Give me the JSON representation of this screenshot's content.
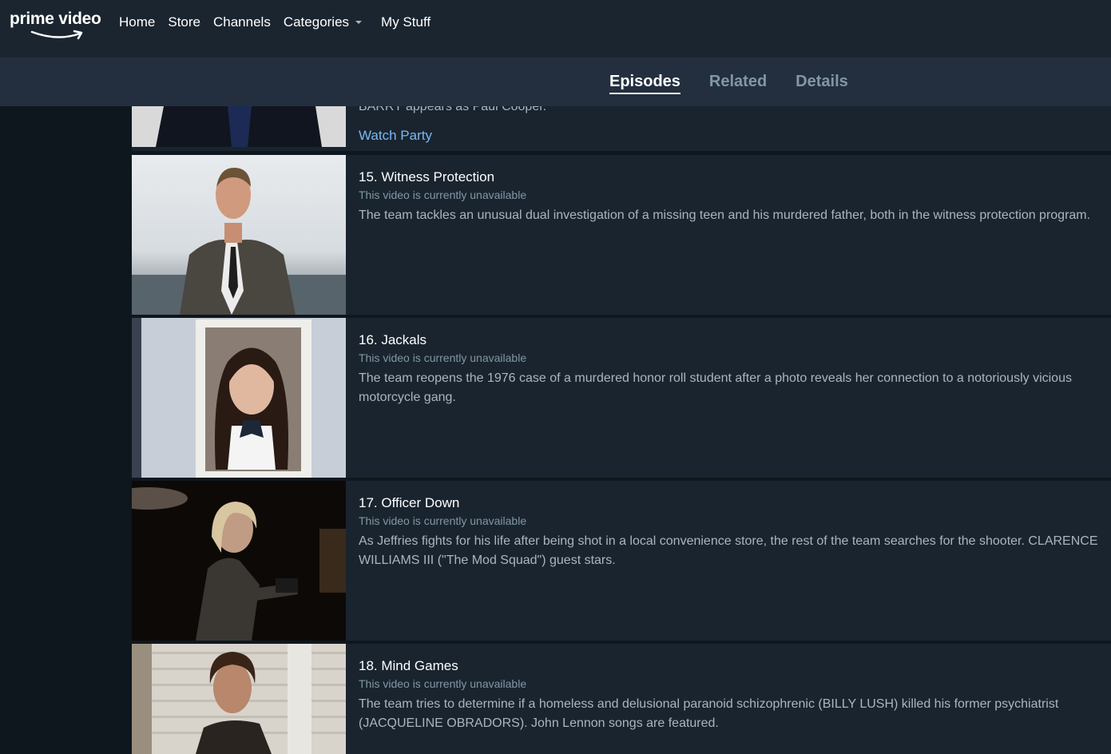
{
  "nav": {
    "logo": "prime video",
    "links": [
      "Home",
      "Store",
      "Channels",
      "Categories",
      "My Stuff"
    ]
  },
  "tabs": {
    "items": [
      "Episodes",
      "Related",
      "Details"
    ],
    "active": "Episodes"
  },
  "partial_episode": {
    "desc_tail": "BARRY appears as Paul Cooper.",
    "action": "Watch Party"
  },
  "episodes": [
    {
      "title": "15. Witness Protection",
      "status": "This video is currently unavailable",
      "description": "The team tackles an unusual dual investigation of a missing teen and his murdered father, both in the witness protection program."
    },
    {
      "title": "16. Jackals",
      "status": "This video is currently unavailable",
      "description": "The team reopens the 1976 case of a murdered honor roll student after a photo reveals her connection to a notoriously vicious motorcycle gang."
    },
    {
      "title": "17. Officer Down",
      "status": "This video is currently unavailable",
      "description": "As Jeffries fights for his life after being shot in a local convenience store, the rest of the team searches for the shooter. CLARENCE WILLIAMS III (\"The Mod Squad\") guest stars."
    },
    {
      "title": "18. Mind Games",
      "status": "This video is currently unavailable",
      "description": "The team tries to determine if a homeless and delusional paranoid schizophrenic (BILLY LUSH) killed his former psychiatrist (JACQUELINE OBRADORS). John Lennon songs are featured."
    }
  ],
  "colors": {
    "page_bg": "#0f171e",
    "nav_bg": "#1b2530",
    "tabs_bg": "#232f3e",
    "row_bg": "#1a242f",
    "link": "#79b8f3",
    "muted": "#8197a4"
  }
}
